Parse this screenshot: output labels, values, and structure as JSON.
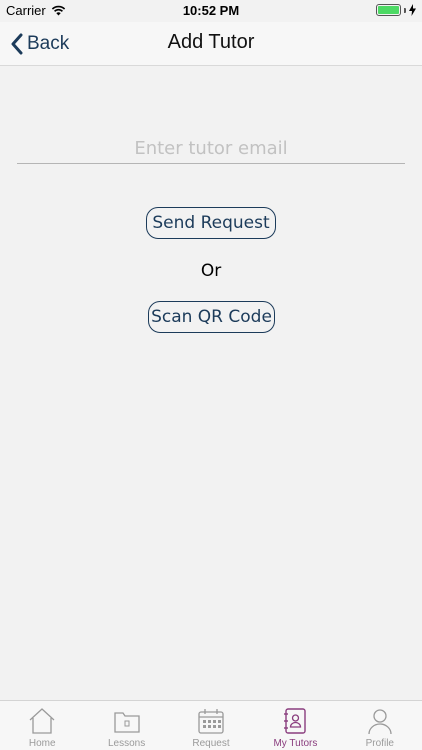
{
  "status_bar": {
    "carrier": "Carrier",
    "time": "10:52 PM"
  },
  "nav": {
    "back_label": "Back",
    "title": "Add Tutor"
  },
  "form": {
    "email_placeholder": "Enter tutor email",
    "email_value": "",
    "send_label": "Send Request",
    "or_label": "Or",
    "scan_label": "Scan QR Code"
  },
  "tab_bar": {
    "active_color": "#8a3d7e",
    "inactive_color": "#9a9a9a",
    "items": [
      {
        "label": "Home",
        "icon": "home-icon"
      },
      {
        "label": "Lessons",
        "icon": "folder-icon"
      },
      {
        "label": "Request",
        "icon": "calendar-icon"
      },
      {
        "label": "My Tutors",
        "icon": "contacts-book-icon",
        "active": true
      },
      {
        "label": "Profile",
        "icon": "person-icon"
      }
    ]
  },
  "colors": {
    "accent": "#1c3b5a",
    "background": "#f2f2f2",
    "battery": "#4cd964"
  }
}
